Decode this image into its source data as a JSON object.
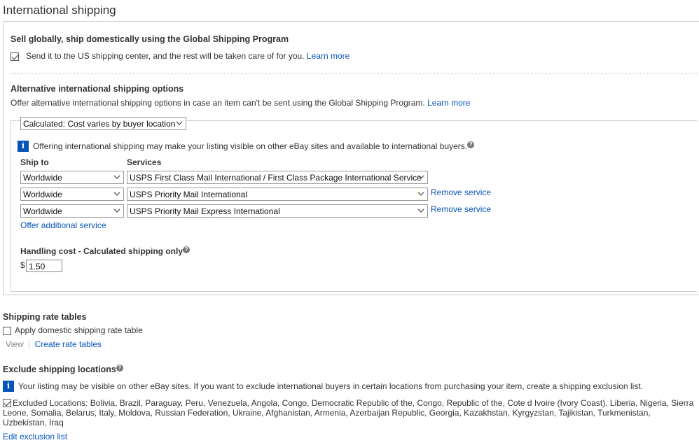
{
  "page": {
    "title": "International shipping"
  },
  "gsp": {
    "heading": "Sell globally, ship domestically using the Global Shipping Program",
    "checkbox_label": "Send it to the US shipping center, and the rest will be taken care of for you.",
    "learn_more": "Learn more",
    "checked": true
  },
  "alt": {
    "heading": "Alternative international shipping options",
    "description": "Offer alternative international shipping options in case an item can't be sent using the Global Shipping Program.",
    "learn_more": "Learn more",
    "cost_type": "Calculated: Cost varies by buyer location",
    "info_text": "Offering international shipping may make your listing visible on other eBay sites and available to international buyers.",
    "ship_to_header": "Ship to",
    "services_header": "Services",
    "rows": [
      {
        "ship_to": "Worldwide",
        "service": "USPS First Class Mail International / First Class Package International Service",
        "remove": ""
      },
      {
        "ship_to": "Worldwide",
        "service": "USPS Priority Mail International",
        "remove": "Remove service"
      },
      {
        "ship_to": "Worldwide",
        "service": "USPS Priority Mail Express International",
        "remove": "Remove service"
      }
    ],
    "offer_additional": "Offer additional service",
    "handling_label": "Handling cost - Calculated shipping only",
    "currency": "$",
    "handling_value": "1.50"
  },
  "rate_tables": {
    "heading": "Shipping rate tables",
    "checkbox_label": "Apply domestic shipping rate table",
    "checked": false,
    "view": "View",
    "create": "Create rate tables"
  },
  "exclude": {
    "heading": "Exclude shipping locations",
    "info_text": "Your listing may be visible on other eBay sites. If you want to exclude international buyers in certain locations from purchasing your item, create a shipping exclusion list.",
    "excluded_text": "Excluded Locations: Bolivia, Brazil, Paraguay, Peru, Venezuela, Angola, Congo, Democratic Republic of the, Congo, Republic of the, Cote d Ivoire (Ivory Coast), Liberia, Nigeria, Sierra Leone, Somalia, Belarus, Italy, Moldova, Russian Federation, Ukraine, Afghanistan, Armenia, Azerbaijan Republic, Georgia, Kazakhstan, Kyrgyzstan, Tajikistan, Turkmenistan, Uzbekistan, Iraq",
    "checked": true,
    "edit_link": "Edit exclusion list"
  },
  "icons": {
    "info": "info-icon",
    "help": "help-icon",
    "chevron": "chevron-down-icon",
    "checkbox": "checkbox"
  },
  "colors": {
    "link": "#0654ba",
    "info_bg": "#0654ba",
    "border": "#cccccc"
  }
}
